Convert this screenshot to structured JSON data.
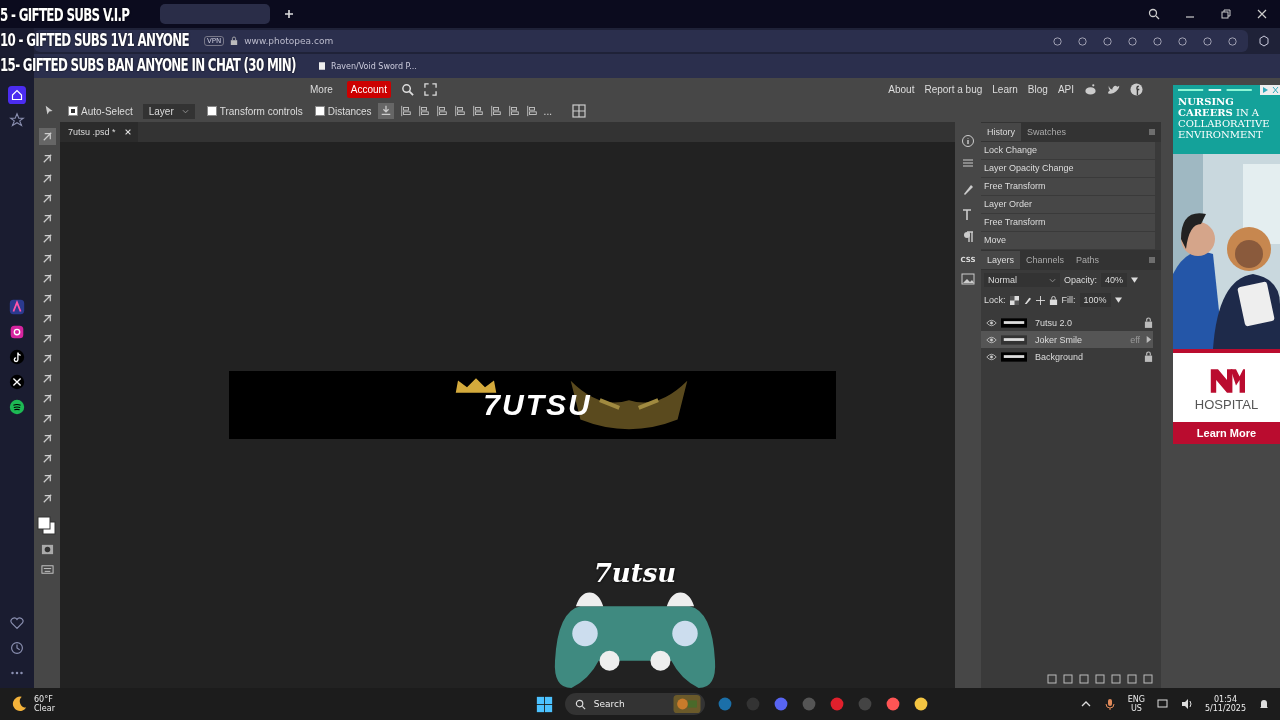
{
  "overlay": {
    "lines": [
      "5 - GIFTED SUBS V.I.P",
      "10 - GIFTED SUBS 1V1 ANYONE",
      "15- GIFTED SUBS BAN ANYONE IN CHAT (30 MIN)"
    ],
    "logo": "7utsu"
  },
  "browser": {
    "vpn": "VPN",
    "url": "www.photopea.com",
    "bookmark": "Raven/Void Sword P..."
  },
  "menu": {
    "items": [
      {
        "label": "More",
        "selected": false
      },
      {
        "label": "Account",
        "selected": true
      }
    ],
    "links": [
      "About",
      "Report a bug",
      "Learn",
      "Blog",
      "API"
    ]
  },
  "toolbar": {
    "auto_select": {
      "label": "Auto-Select",
      "checked": true
    },
    "target": "Layer",
    "transform_controls": {
      "label": "Transform controls",
      "checked": false
    },
    "distances": {
      "label": "Distances",
      "checked": false
    },
    "more": "..."
  },
  "document_tab": "7utsu .psd *",
  "banner_text": "7UTSU",
  "side_icons": {
    "css": "CSS"
  },
  "history": {
    "tabs": [
      {
        "label": "History",
        "selected": true
      },
      {
        "label": "Swatches",
        "selected": false
      }
    ],
    "items": [
      "Lock Change",
      "Layer Opacity Change",
      "Free Transform",
      "Layer Order",
      "Free Transform",
      "Move"
    ]
  },
  "layers": {
    "tabs": [
      {
        "label": "Layers",
        "selected": true
      },
      {
        "label": "Channels",
        "selected": false
      },
      {
        "label": "Paths",
        "selected": false
      }
    ],
    "blend_mode": "Normal",
    "opacity_label": "Opacity:",
    "opacity": "40%",
    "lock_label": "Lock:",
    "fill_label": "Fill:",
    "fill": "100%",
    "items": [
      {
        "name": "7utsu 2.0",
        "selected": false,
        "locked": true
      },
      {
        "name": "Joker Smile",
        "selected": true,
        "locked": false,
        "badge": "eff"
      },
      {
        "name": "Background",
        "selected": false,
        "locked": true
      }
    ]
  },
  "ad": {
    "headline": "**NURSING CAREERS** IN A COLLABORATIVE ENVIRONMENT",
    "brand": "HOSPITAL",
    "cta": "Learn More"
  },
  "taskbar": {
    "temperature": "60°F",
    "condition": "Clear",
    "search": "Search",
    "lang": "ENG",
    "region": "US",
    "time": "01:54",
    "date": "5/11/2025"
  }
}
